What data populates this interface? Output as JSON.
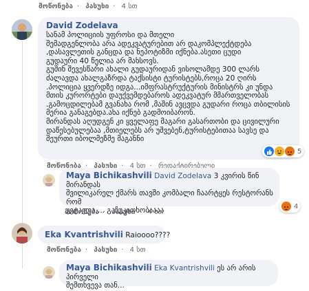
{
  "actions": {
    "like": "მოწონება",
    "reply": "პასუხი",
    "sep": "·"
  },
  "top_fragment": {
    "time": "4 სთ"
  },
  "comments": [
    {
      "author": "David Zodelava",
      "lines": [
        "სანამ პოლიციის უფროსი და მთელი",
        "შემადგენლობა არა ადეკვატურებით არ დაკომპლექტდება",
        ",დასავლეთის განცდა და ნეპოტიზმი იქნება.ასეთი ცუდი",
        "გუდაური 40 წელია არ მახსოვს.",
        "გუშინ შევესწარი ახალი გუდაურიდან ვისოლამდე 300 ლარს",
        "ძალავდა ახალგაზრდა ტაქსისტი ტურისტებს,როცა 20 ღირს",
        ".პოლიცია ყვერდზე იდგა...იმფრასტრუქტურის მინისტრს კი უნდა",
        "მთის კურორტები დაუქვემდებაროს ადეკვატურ მმართველობას",
        ".გამოცდილებამ გვანახა რომ ,მაშინ ავცვდა გუდარი როცა თბილისის",
        "მერია განაგებდა.ახა იქნებ გადმოიბარონ.",
        "მირანდას აღუდგენ კი ყველაფე მაგარი გასართობი და ცივილური",
        "დაწესებულებაა ,მთიელებს არ უშვებენ,ტურისტებითაა სავსე და",
        "შეურთი იბოლმეზმე მაგანნი"
      ],
      "time": "4 სთ",
      "edited": "რედაქტირებული",
      "reaction_count": "5"
    },
    {
      "author": "Maya Bichikashvili",
      "tag": "David Zodelava",
      "line1_rest": " 3 კვირის წინ მირანდას",
      "lines": [
        "შვილიკარელ ქმარს თავში კომბალი ჩაარტყეს რესტორანს რომ",
        "კეტავდა.... გაჩუკითხობაააა"
      ],
      "time": "4 სთ",
      "reaction_count": "4"
    },
    {
      "author": "Eka Kvantrishvili",
      "text": "Raiоооо????",
      "time": "4 სთ"
    },
    {
      "author": "Maya Bichikashvili",
      "tag": "Eka Kvantrishvili",
      "line1_rest": " ეს არ არის პირველი",
      "lines": [
        "შემთხვევა თან..."
      ]
    }
  ],
  "colors": {
    "link": "#385898",
    "bubble": "#f0f2f5",
    "meta": "#65676b"
  }
}
